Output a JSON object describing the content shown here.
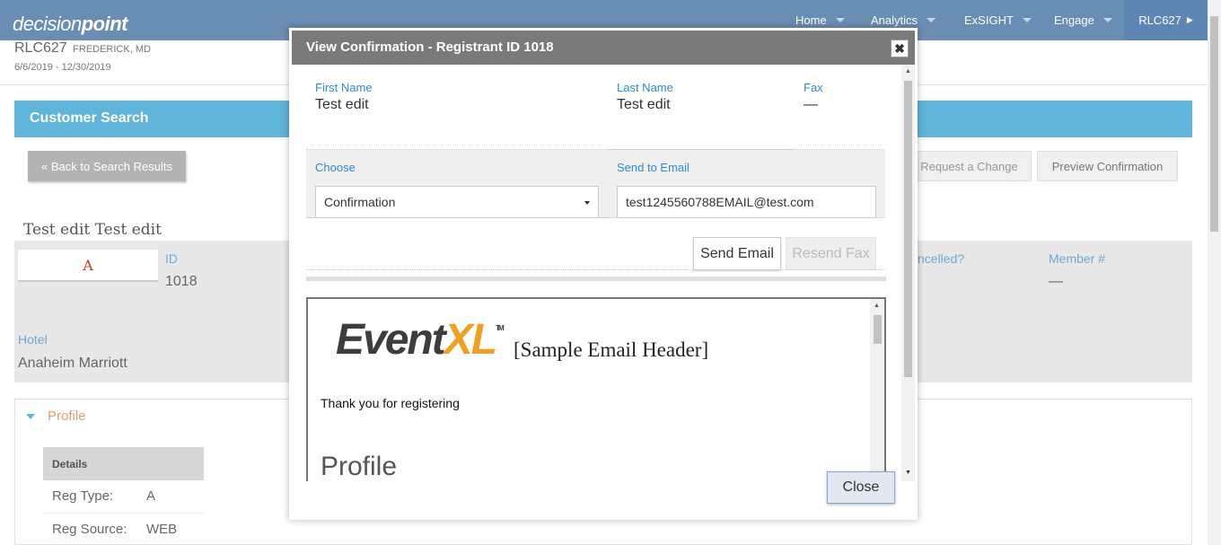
{
  "app": {
    "logo_part1": "decision",
    "logo_part2": "point"
  },
  "nav": {
    "items": [
      {
        "label": "Home"
      },
      {
        "label": "Analytics"
      },
      {
        "label": "ExSIGHT"
      },
      {
        "label": "Engage"
      },
      {
        "label": "RLC627"
      }
    ]
  },
  "header": {
    "code": "RLC627",
    "location": "FREDERICK, MD",
    "dates": "6/6/2019 - 12/30/2019"
  },
  "customer_search": {
    "title": "Customer Search",
    "back_label": "« Back to Search Results",
    "request_change_label": "Request a Change",
    "preview_label": "Preview Confirmation"
  },
  "registrant": {
    "name": "Test edit Test edit",
    "avatar_letter": "A",
    "id_label": "ID",
    "id_value": "1018",
    "cancelled_label": "ncelled?",
    "member_label": "Member #",
    "member_value": "—",
    "hotel_label": "Hotel",
    "hotel_value": "Anaheim Marriott"
  },
  "profile": {
    "title": "Profile",
    "details_header": "Details",
    "rows": [
      {
        "label": "Reg Type:",
        "value": "A"
      },
      {
        "label": "Reg Source:",
        "value": "WEB"
      }
    ]
  },
  "modal": {
    "title": "View Confirmation - Registrant ID 1018",
    "close_x": "✖",
    "first_name_label": "First Name",
    "first_name_value": "Test edit",
    "last_name_label": "Last Name",
    "last_name_value": "Test edit",
    "fax_label": "Fax",
    "fax_value": "—",
    "choose_label": "Choose",
    "choose_value": "Confirmation",
    "email_label": "Send to Email",
    "email_value": "test1245560788EMAIL@test.com",
    "send_email_label": "Send Email",
    "resend_fax_label": "Resend Fax",
    "close_label": "Close",
    "preview": {
      "logo_event": "Event",
      "logo_xl": "XL",
      "logo_tm": "TM",
      "header_text": "[Sample Email Header]",
      "thanks": "Thank you for registering",
      "section_title": "Profile"
    }
  },
  "colors": {
    "topbar": "#6a8db3",
    "accent_blue": "#5fb4d9",
    "link_blue": "#2d8bd0",
    "orange": "#f0a020"
  }
}
